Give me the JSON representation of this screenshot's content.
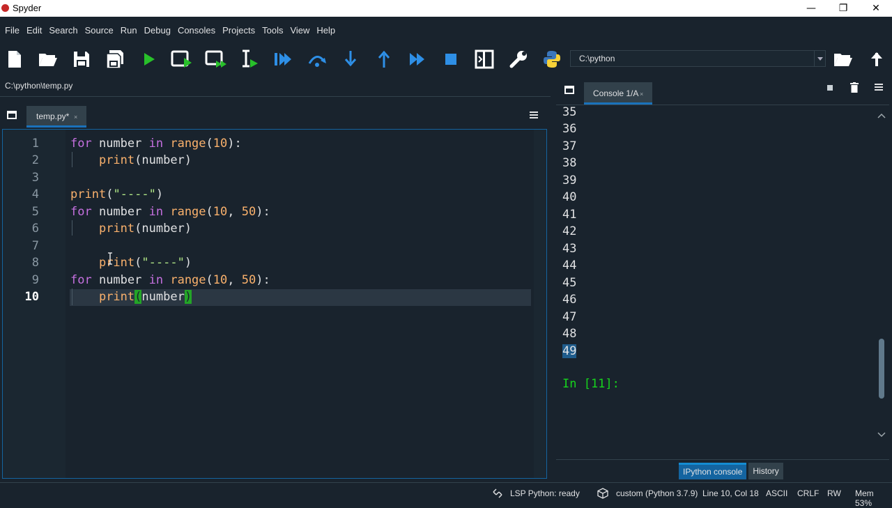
{
  "app": {
    "title": "Spyder"
  },
  "window_controls": {
    "minimize": "—",
    "maximize": "❐",
    "close": "✕"
  },
  "menu": [
    "File",
    "Edit",
    "Search",
    "Source",
    "Run",
    "Debug",
    "Consoles",
    "Projects",
    "Tools",
    "View",
    "Help"
  ],
  "toolbar": {
    "working_dir": "C:\\python",
    "icons": [
      "new-file-icon",
      "open-folder-icon",
      "save-icon",
      "save-all-icon",
      "run-icon",
      "run-cell-icon",
      "run-cell-advance-icon",
      "run-selection-icon",
      "debug-icon",
      "step-over-icon",
      "step-into-icon",
      "step-return-icon",
      "continue-icon",
      "stop-icon",
      "maximize-pane-icon",
      "preferences-wrench-icon",
      "python-path-icon"
    ]
  },
  "editor": {
    "file_path": "C:\\python\\temp.py",
    "tab_label": "temp.py*",
    "tab_close": "×",
    "line_numbers": [
      "1",
      "2",
      "3",
      "4",
      "5",
      "6",
      "7",
      "8",
      "9",
      "10"
    ],
    "current_line": "10"
  },
  "console": {
    "tab_label": "Console 1/A",
    "tab_close": "×",
    "output_lines": [
      "35",
      "36",
      "37",
      "38",
      "39",
      "40",
      "41",
      "42",
      "43",
      "44",
      "45",
      "46",
      "47",
      "48",
      "49"
    ],
    "selected_line": "49",
    "prompt": "In [11]:",
    "bottom_tabs": [
      "IPython console",
      "History"
    ]
  },
  "status": {
    "lsp": "LSP Python: ready",
    "env": "custom (Python 3.7.9)",
    "position": "Line 10, Col 18",
    "encoding": "ASCII",
    "eol": "CRLF",
    "mode": "RW",
    "mem": "Mem 53%"
  },
  "colors": {
    "accent": "#1a72bb",
    "background": "#19232d",
    "keyword": "#c670e0",
    "function": "#fab16c",
    "string": "#b0e686",
    "prompt": "#16d41d",
    "run_green": "#28c02a",
    "debug_blue": "#2e8fe6"
  }
}
